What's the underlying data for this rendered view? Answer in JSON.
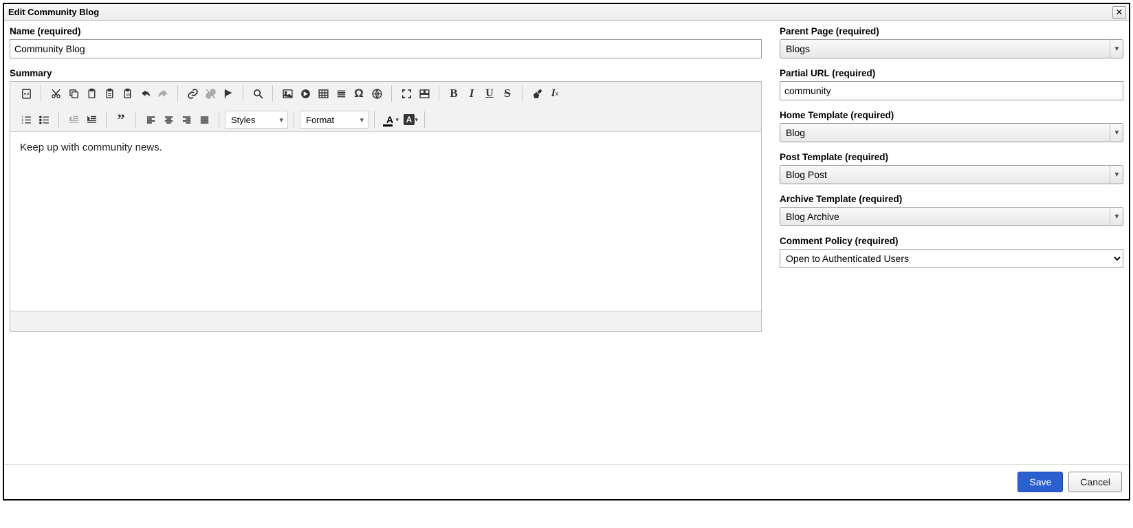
{
  "dialog": {
    "title": "Edit Community Blog"
  },
  "left": {
    "name_label": "Name (required)",
    "name_value": "Community Blog",
    "summary_label": "Summary",
    "summary_body": "Keep up with community news.",
    "toolbar": {
      "styles_label": "Styles",
      "format_label": "Format"
    }
  },
  "right": {
    "parent_label": "Parent Page (required)",
    "parent_value": "Blogs",
    "partial_url_label": "Partial URL (required)",
    "partial_url_value": "community",
    "home_template_label": "Home Template (required)",
    "home_template_value": "Blog",
    "post_template_label": "Post Template (required)",
    "post_template_value": "Blog Post",
    "archive_template_label": "Archive Template (required)",
    "archive_template_value": "Blog Archive",
    "comment_policy_label": "Comment Policy (required)",
    "comment_policy_value": "Open to Authenticated Users"
  },
  "footer": {
    "save_label": "Save",
    "cancel_label": "Cancel"
  }
}
